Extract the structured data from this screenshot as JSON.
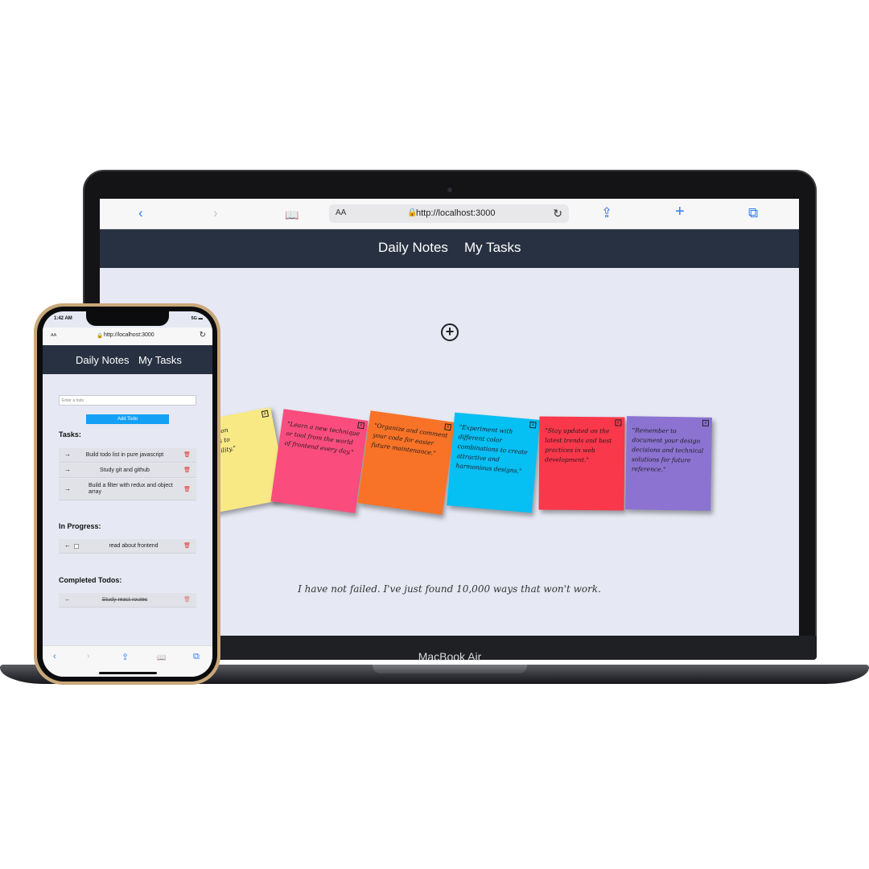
{
  "desktop": {
    "url": "http://localhost:3000",
    "text_size_label": "AA",
    "lock_glyph": "🔒",
    "reload_glyph": "↻",
    "toolbar_icons": {
      "back": "‹",
      "forward": "›",
      "bookmarks": "📖",
      "share": "⇪",
      "new_tab": "+",
      "tabs": "⧉"
    },
    "nav": {
      "daily_notes": "Daily Notes",
      "my_tasks": "My Tasks"
    },
    "add_note_glyph": "+",
    "notes": [
      {
        "text": "our code on\n browsers to\nompatibility.\"",
        "color": "#f8e985"
      },
      {
        "text": "\"Learn a new technique or tool from the world of frontend every day.\"",
        "color": "#fa4d7d"
      },
      {
        "text": "\"Organize and comment your code for easier future maintenance.\"",
        "color": "#f87327"
      },
      {
        "text": "\"Experiment with different color combinations to create attractive and harmonious designs.\"",
        "color": "#06bff3"
      },
      {
        "text": "\"Stay updated on the latest trends and best practices in web development.\"",
        "color": "#f9384b"
      },
      {
        "text": "\"Remember to document your design decisions and technical solutions for future reference.\"",
        "color": "#8c73d2"
      }
    ],
    "note_close_glyph": "x",
    "quote": "I have not failed. I've just found 10,000 ways that won't work.",
    "brand": "MacBook Air"
  },
  "mobile": {
    "status_time": "1:42 AM",
    "status_right": "5G ▬",
    "url": "http://localhost:3000",
    "text_size_label": "AA",
    "lock_glyph": "🔒",
    "reload_glyph": "↻",
    "nav": {
      "daily_notes": "Daily Notes",
      "my_tasks": "My Tasks"
    },
    "input_placeholder": "Enter a todo",
    "add_button": "Add Todo",
    "sections": {
      "tasks": "Tasks:",
      "in_progress": "In Progress:",
      "completed": "Completed Todos:"
    },
    "tasks": [
      "Build todo list in pure javascript",
      "Study git and github",
      "Build a filter with redux and object array"
    ],
    "in_progress": [
      "read about frontend"
    ],
    "completed": [
      "Study react routes"
    ],
    "arrow_right": "→",
    "arrow_left": "←",
    "trash_glyph": "🗑",
    "bottom_icons": {
      "back": "‹",
      "forward": "›",
      "share": "⇪",
      "bookmarks": "📖",
      "tabs": "⧉"
    }
  }
}
